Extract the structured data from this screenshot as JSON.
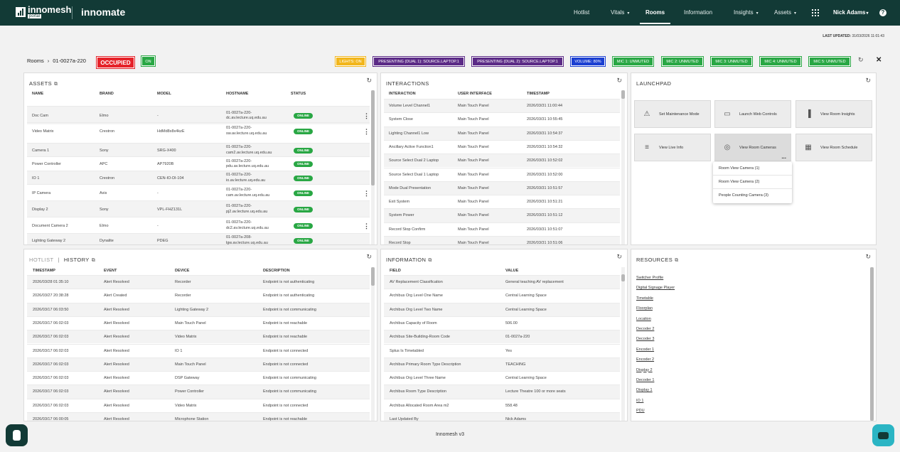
{
  "header": {
    "brand_top": "innomesh",
    "brand_sub": "portal",
    "brand2": "innomate",
    "nav": [
      {
        "label": "Hotlist",
        "caret": false,
        "active": false
      },
      {
        "label": "Vitals",
        "caret": true,
        "active": false
      },
      {
        "label": "Rooms",
        "caret": false,
        "active": true
      },
      {
        "label": "Information",
        "caret": false,
        "active": false
      },
      {
        "label": "Insights",
        "caret": true,
        "active": false
      },
      {
        "label": "Assets",
        "caret": true,
        "active": false
      }
    ],
    "user": "Nick Adams",
    "user_caret": "▾",
    "help": "?",
    "caret_glyph": "▾"
  },
  "last_updated": {
    "label": "LAST UPDATED:",
    "value": "31/03/2026 11:01:43"
  },
  "breadcrumb": {
    "root": "Rooms",
    "sep": "›",
    "room": "01-0027a-220"
  },
  "occupancy": "OCCUPIED",
  "power": "ON",
  "status_chips": [
    {
      "label": "LIGHTS: ON",
      "color": "#f2b61b"
    },
    {
      "label": "PRESENTING (DUAL 1): SOURCE.LAPTOP.1",
      "color": "#5b2a86"
    },
    {
      "label": "PRESENTING (DUAL 2): SOURCE.LAPTOP.1",
      "color": "#5b2a86"
    },
    {
      "label": "VOLUME: 80%",
      "color": "#1b3fd1"
    },
    {
      "label": "MIC 1: UNMUTED",
      "color": "#29a744"
    },
    {
      "label": "MIC 2: UNMUTED",
      "color": "#29a744"
    },
    {
      "label": "MIC 3: UNMUTED",
      "color": "#29a744"
    },
    {
      "label": "MIC 4: UNMUTED",
      "color": "#29a744"
    },
    {
      "label": "MIC 5: UNMUTED",
      "color": "#29a744"
    }
  ],
  "glyphs": {
    "refresh": "↻",
    "close": "✕",
    "ext": "⧉",
    "kebab": "⋮",
    "dots": "..."
  },
  "assets": {
    "title": "ASSETS",
    "columns": [
      "NAME",
      "BRAND",
      "MODEL",
      "HOSTNAME",
      "STATUS"
    ],
    "rows": [
      {
        "name": "Doc Cam",
        "brand": "Elmo",
        "model": "-",
        "host1": "01-0027a-220-",
        "host2": "dc.av.lecture.uq.edu.au",
        "status": "ONLINE",
        "menu": true
      },
      {
        "name": "Video Matrix",
        "brand": "Crestron",
        "model": "HdMd8x8x4kzE",
        "host1": "01-0027a-220-",
        "host2": "sw.av.lecture.uq.edu.au",
        "status": "ONLINE",
        "menu": true
      },
      {
        "name": "Camera 1",
        "brand": "Sony",
        "model": "SRG-X400",
        "host1": "01-0027a-220-",
        "host2": "cam2.av.lecture.uq.edu.au",
        "status": "ONLINE",
        "menu": false
      },
      {
        "name": "Power Controller",
        "brand": "APC",
        "model": "AP7920B",
        "host1": "01-0027a-220-",
        "host2": "pdu.av.lecture.uq.edu.au",
        "status": "ONLINE",
        "menu": false
      },
      {
        "name": "IO 1",
        "brand": "Crestron",
        "model": "CEN-IO-DI-104",
        "host1": "01-0027a-220-",
        "host2": "io.av.lecture.uq.edu.au",
        "status": "ONLINE",
        "menu": false
      },
      {
        "name": "IP Camera",
        "brand": "Axis",
        "model": "-",
        "host1": "01-0027a-220-",
        "host2": "cam.av.lecture.uq.edu.au",
        "status": "ONLINE",
        "menu": true
      },
      {
        "name": "Display 2",
        "brand": "Sony",
        "model": "VPL-FHZ131L",
        "host1": "01-0027a-220-",
        "host2": "pj2.av.lecture.uq.edu.au",
        "status": "ONLINE",
        "menu": false
      },
      {
        "name": "Document Camera 2",
        "brand": "Elmo",
        "model": "-",
        "host1": "01-0027a-220-",
        "host2": "dc2.av.lecture.uq.edu.au",
        "status": "ONLINE",
        "menu": true
      },
      {
        "name": "Lighting Gateway 2",
        "brand": "Dynalite",
        "model": "PDEG",
        "host1": "01-0027a-208-",
        "host2": "lgw.av.lecture.uq.edu.au",
        "status": "ONLINE",
        "menu": false
      }
    ]
  },
  "interactions": {
    "title": "INTERACTIONS",
    "columns": [
      "INTERACTION",
      "USER INTERFACE",
      "TIMESTAMP"
    ],
    "rows": [
      [
        "Volume Level Channel1",
        "Main Touch Panel",
        "2026/03/31 11:00:44"
      ],
      [
        "System Close",
        "Main Touch Panel",
        "2026/03/31 10:55:45"
      ],
      [
        "Lighting Channel1 Low",
        "Main Touch Panel",
        "2026/03/31 10:54:37"
      ],
      [
        "Ancillary Active Function1",
        "Main Touch Panel",
        "2026/03/31 10:54:32"
      ],
      [
        "Source Select Dual 2 Laptop",
        "Main Touch Panel",
        "2026/03/31 10:52:02"
      ],
      [
        "Source Select Dual 1 Laptop",
        "Main Touch Panel",
        "2026/03/31 10:52:00"
      ],
      [
        "Mode Dual Presentation",
        "Main Touch Panel",
        "2026/03/31 10:51:57"
      ],
      [
        "Exit System",
        "Main Touch Panel",
        "2026/03/31 10:51:21"
      ],
      [
        "System Power",
        "Main Touch Panel",
        "2026/03/31 10:51:12"
      ],
      [
        "Record Stop Confirm",
        "Main Touch Panel",
        "2026/03/31 10:51:07"
      ],
      [
        "Record Stop",
        "Main Touch Panel",
        "2026/03/31 10:51:06"
      ]
    ]
  },
  "launchpad": {
    "title": "LAUNCHPAD",
    "tiles": [
      {
        "label": "Set Maintenance Mode",
        "icon": "⚠"
      },
      {
        "label": "Launch Web Controls",
        "icon": "▭"
      },
      {
        "label": "View Room Insights",
        "icon": "▐"
      },
      {
        "label": "View Live Info",
        "icon": "≡"
      },
      {
        "label": "View Room Cameras",
        "icon": "◎"
      },
      {
        "label": "View Room Schedule",
        "icon": "▦"
      }
    ],
    "camera_menu": [
      "Room View Camera (1)",
      "Room View Camera (2)",
      "People Counting Camera (3)"
    ]
  },
  "history": {
    "tab1": "HOTLIST",
    "sep": "|",
    "tab2": "HISTORY",
    "columns": [
      "TIMESTAMP",
      "EVENT",
      "DEVICE",
      "DESCRIPTION"
    ],
    "rows": [
      [
        "2026/03/28 01:35:10",
        "Alert Resolved",
        "Recorder",
        "Endpoint is not authenticating"
      ],
      [
        "2026/03/27 20:38:28",
        "Alert Created",
        "Recorder",
        "Endpoint is not authenticating"
      ],
      [
        "2026/03/17 06:03:50",
        "Alert Resolved",
        "Lighting Gateway 2",
        "Endpoint is not communicating"
      ],
      [
        "2026/03/17 06:02:03",
        "Alert Resolved",
        "Main Touch Panel",
        "Endpoint is not reachable"
      ],
      [
        "2026/03/17 06:02:03",
        "Alert Resolved",
        "Video Matrix",
        "Endpoint is not reachable"
      ],
      [
        "2026/03/17 06:02:03",
        "Alert Resolved",
        "IO 1",
        "Endpoint is not connected"
      ],
      [
        "2026/03/17 06:02:03",
        "Alert Resolved",
        "Main Touch Panel",
        "Endpoint is not connected"
      ],
      [
        "2026/03/17 06:02:03",
        "Alert Resolved",
        "DSP Gateway",
        "Endpoint is not communicating"
      ],
      [
        "2026/03/17 06:02:03",
        "Alert Resolved",
        "Power Controller",
        "Endpoint is not communicating"
      ],
      [
        "2026/03/17 06:02:03",
        "Alert Resolved",
        "Video Matrix",
        "Endpoint is not connected"
      ],
      [
        "2026/03/17 06:00:05",
        "Alert Resolved",
        "Microphone Station",
        "Endpoint is not reachable"
      ]
    ]
  },
  "information": {
    "title": "INFORMATION",
    "columns": [
      "FIELD",
      "VALUE"
    ],
    "rows": [
      [
        "AV Replacement Classification",
        "General teaching AV replacement"
      ],
      [
        "Archibus Org Level One Name",
        "Central Learning Space"
      ],
      [
        "Archibus Org Level Two Name",
        "Central Learning Space"
      ],
      [
        "Archibus Capacity of Room",
        "506.00"
      ],
      [
        "Archibus Site-Building-Room Code",
        "01-0027a-220"
      ],
      [
        "Splus Is Timetabled",
        "Yes"
      ],
      [
        "Archibus Primary Room Type Description",
        "TEACHING"
      ],
      [
        "Archibus Org Level Three Name",
        "Central Learning Space"
      ],
      [
        "Archibus Room Type Description",
        "Lecture Theatre 100 or more seats"
      ],
      [
        "Archibus Allocated Room Area m2",
        "558.48"
      ],
      [
        "Last Updated By",
        "Nick Adams"
      ]
    ]
  },
  "resources": {
    "title": "RESOURCES",
    "items": [
      "Switcher Profile",
      "Digital Signage Player",
      "Timetable",
      "Floorplan",
      "Location",
      "Decoder 2",
      "Decoder 3",
      "Encoder 1",
      "Encoder 2",
      "Display 2",
      "Decoder 1",
      "Display 1",
      "IO 1",
      "PDU"
    ]
  },
  "footer": "Innomesh v3"
}
